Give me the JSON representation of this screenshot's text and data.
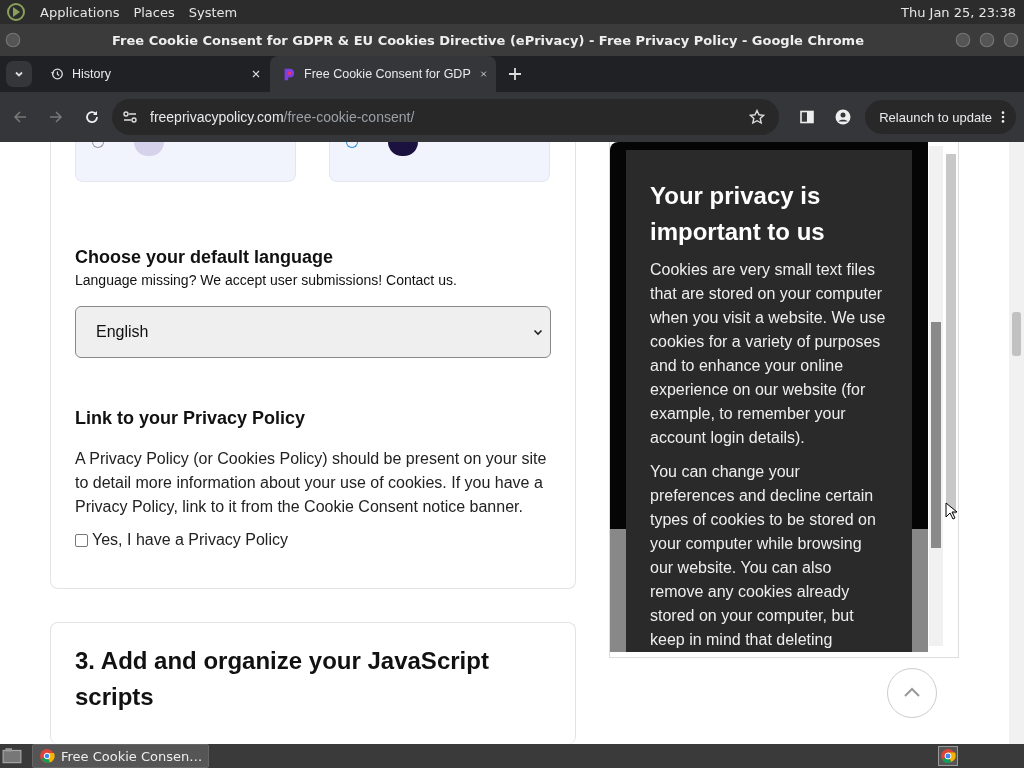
{
  "top_panel": {
    "menus": [
      "Applications",
      "Places",
      "System"
    ],
    "clock": "Thu Jan 25, 23:38"
  },
  "window": {
    "title": "Free Cookie Consent for GDPR & EU Cookies Directive (ePrivacy) - Free Privacy Policy - Google Chrome"
  },
  "tabs": [
    {
      "label": "History",
      "selected": false,
      "kind": "history"
    },
    {
      "label": "Free Cookie Consent for GDP",
      "selected": true,
      "kind": "site"
    }
  ],
  "toolbar": {
    "url_domain": "freeprivacypolicy.com",
    "url_path": "/free-cookie-consent/",
    "relaunch": "Relaunch to update"
  },
  "themes": [
    {
      "selected": false,
      "color": "#d6d2ec"
    },
    {
      "selected": true,
      "color": "#1c1240"
    }
  ],
  "language": {
    "title": "Choose your default language",
    "note": "Language missing? We accept user submissions! Contact us.",
    "value": "English"
  },
  "policy": {
    "title": "Link to your Privacy Policy",
    "text": "A Privacy Policy (or Cookies Policy) should be present on your site to detail more information about your use of cookies. If you have a Privacy Policy, link to it from the Cookie Consent notice banner.",
    "checkbox": {
      "label": "Yes, I have a Privacy Policy",
      "checked": false
    }
  },
  "step3": {
    "title": "3. Add and organize your JavaScript scripts"
  },
  "preview": {
    "heading": "Your privacy is important to us",
    "paragraphs": [
      "Cookies are very small text files that are stored on your computer when you visit a website. We use cookies for a variety of purposes and to enhance your online experience on our website (for example, to remember your account login details).",
      "You can change your preferences and decline certain types of cookies to be stored on your computer while browsing our website. You can also remove any cookies already stored on your computer, but keep in mind that deleting"
    ]
  },
  "taskbar": {
    "items": [
      {
        "label": "Free Cookie Consen…",
        "selected": true
      }
    ]
  }
}
